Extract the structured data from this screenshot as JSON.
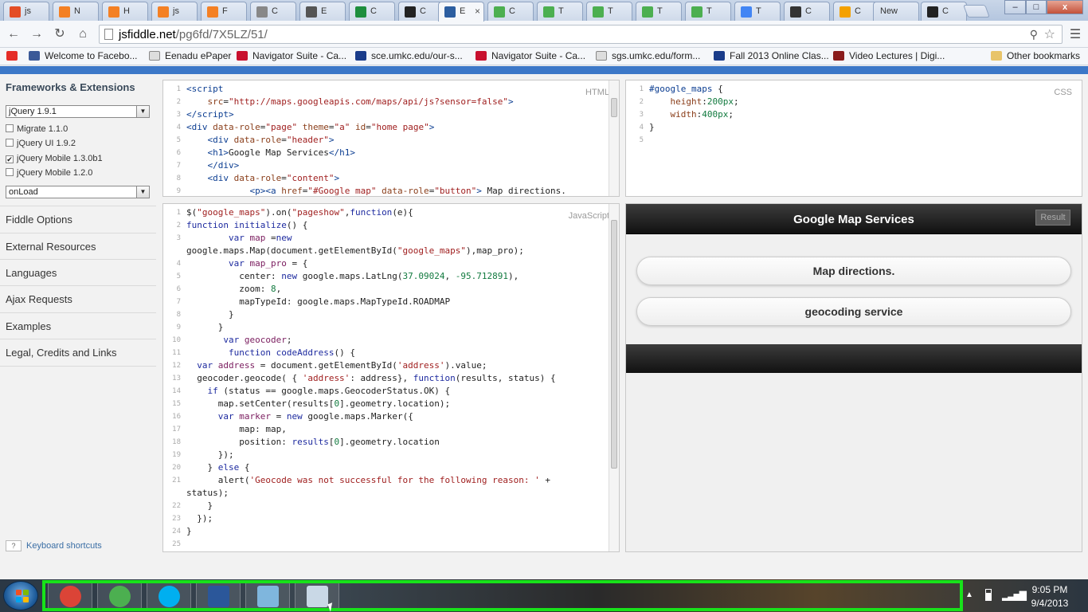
{
  "browser": {
    "tabs": [
      {
        "icon": "html5-icon",
        "label": "js",
        "color": "#e44d26"
      },
      {
        "icon": "stackoverflow-icon",
        "label": "N",
        "color": "#f48024"
      },
      {
        "icon": "stackoverflow-icon",
        "label": "H",
        "color": "#f48024"
      },
      {
        "icon": "stackoverflow-icon",
        "label": "js",
        "color": "#f48024"
      },
      {
        "icon": "stackoverflow-icon",
        "label": "F",
        "color": "#f48024"
      },
      {
        "icon": "search-icon",
        "label": "C",
        "color": "#888888"
      },
      {
        "icon": "book-icon",
        "label": "E",
        "color": "#555555"
      },
      {
        "icon": "spreadsheet-icon",
        "label": "C",
        "color": "#1e8e3e"
      },
      {
        "icon": "github-icon",
        "label": "C",
        "color": "#222222"
      },
      {
        "icon": "jsfiddle-icon",
        "label": "E",
        "color": "#2c5ea0",
        "active": true
      },
      {
        "icon": "chart-icon",
        "label": "C",
        "color": "#4caf50"
      },
      {
        "icon": "chart-icon",
        "label": "T",
        "color": "#4caf50"
      },
      {
        "icon": "chart-icon",
        "label": "T",
        "color": "#4caf50"
      },
      {
        "icon": "chart-icon",
        "label": "T",
        "color": "#4caf50"
      },
      {
        "icon": "chart-icon",
        "label": "T",
        "color": "#4caf50"
      },
      {
        "icon": "google-icon",
        "label": "T",
        "color": "#4285f4"
      },
      {
        "icon": "wikipedia-icon",
        "label": "C",
        "color": "#333333"
      },
      {
        "icon": "orange-icon",
        "label": "C",
        "color": "#f4a100"
      },
      {
        "icon": "none",
        "label": "New",
        "color": "#bbbbbb"
      },
      {
        "icon": "github-icon",
        "label": "C",
        "color": "#222222"
      }
    ],
    "active_tab_close": "×",
    "window_buttons": {
      "minimize": "–",
      "maximize": "□",
      "close": "x"
    },
    "url_host": "jsfiddle.net",
    "url_path": "/pg6fd/7X5LZ/51/",
    "bookmarks": [
      {
        "icon": "youtube-icon",
        "label": "",
        "color": "#e52d27"
      },
      {
        "icon": "facebook-icon",
        "label": "Welcome to Facebo...",
        "color": "#3b5998"
      },
      {
        "icon": "page-icon",
        "label": "Eenadu ePaper",
        "color": "#dddddd"
      },
      {
        "icon": "umkc-icon",
        "label": "Navigator Suite - Ca...",
        "color": "#c8102e"
      },
      {
        "icon": "umkc-icon",
        "label": "sce.umkc.edu/our-s...",
        "color": "#1a3c8a"
      },
      {
        "icon": "umkc-icon",
        "label": "Navigator Suite - Ca...",
        "color": "#c8102e"
      },
      {
        "icon": "page-icon",
        "label": "sgs.umkc.edu/form...",
        "color": "#dddddd"
      },
      {
        "icon": "umkc-icon",
        "label": "Fall 2013 Online Clas...",
        "color": "#1a3c8a"
      },
      {
        "icon": "nptel-icon",
        "label": "Video Lectures | Digi...",
        "color": "#8a1c1c"
      }
    ],
    "other_bookmarks": "Other bookmarks"
  },
  "sidebar": {
    "title": "Frameworks & Extensions",
    "framework_select": "jQuery 1.9.1",
    "extensions": [
      {
        "label": "Migrate 1.1.0",
        "checked": false
      },
      {
        "label": "jQuery UI 1.9.2",
        "checked": false
      },
      {
        "label": "jQuery Mobile 1.3.0b1",
        "checked": true
      },
      {
        "label": "jQuery Mobile 1.2.0",
        "checked": false
      }
    ],
    "check_mark": "✔",
    "load_select": "onLoad",
    "links": [
      "Fiddle Options",
      "External Resources",
      "Languages",
      "Ajax Requests",
      "Examples",
      "Legal, Credits and Links"
    ],
    "keyboard_key": "?",
    "keyboard_shortcuts": "Keyboard shortcuts"
  },
  "editors": {
    "html_label": "HTML",
    "css_label": "CSS",
    "js_label": "JavaScript",
    "result_label": "Result"
  },
  "result": {
    "title": "Google Map Services",
    "buttons": [
      "Map directions.",
      "geocoding service"
    ]
  },
  "taskbar": {
    "apps": [
      {
        "icon": "chrome-icon",
        "color": "#db4437"
      },
      {
        "icon": "utorrent-icon",
        "color": "#4caf50"
      },
      {
        "icon": "skype-icon",
        "color": "#00aff0"
      },
      {
        "icon": "word-icon",
        "color": "#2b579a"
      },
      {
        "icon": "notepad-icon",
        "color": "#7fb6dd"
      },
      {
        "icon": "window-icon",
        "color": "#c9d8e6"
      }
    ],
    "time": "9:05 PM",
    "date": "9/4/2013"
  }
}
